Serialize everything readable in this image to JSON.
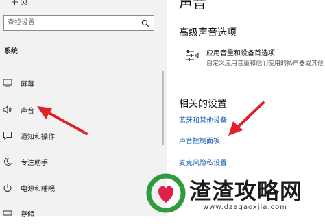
{
  "sidebar": {
    "home_title": "主页",
    "search_placeholder": "查找设置",
    "section_label": "系统",
    "items": [
      {
        "label": "屏幕",
        "icon": "monitor-icon"
      },
      {
        "label": "声音",
        "icon": "speaker-icon"
      },
      {
        "label": "通知和操作",
        "icon": "notification-icon"
      },
      {
        "label": "专注助手",
        "icon": "moon-icon"
      },
      {
        "label": "电源和睡眠",
        "icon": "power-icon"
      },
      {
        "label": "存储",
        "icon": "storage-icon"
      }
    ]
  },
  "main": {
    "page_title": "声音",
    "advanced_heading": "高级声音选项",
    "option": {
      "icon": "sliders-icon",
      "title": "应用音量和设备首选项",
      "description": "自定义应用音量和他们使用的扬声器或其他设备。"
    },
    "related_heading": "相关的设置",
    "links": [
      "蓝牙和其他设备",
      "声音控制面板",
      "麦克风隐私设置"
    ]
  },
  "watermark": {
    "brand_text": "渣渣攻略网",
    "url": "www.dzagaoxjia.com",
    "colors": {
      "heart": "#e0224a",
      "ring": "#2e9b3e"
    }
  },
  "annotations": {
    "arrow_color": "#e0202a"
  }
}
